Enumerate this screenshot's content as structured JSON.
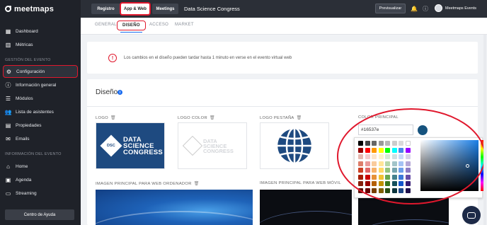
{
  "brand": {
    "name": "meetmaps",
    "logo_icon": "meetmaps-logo-icon"
  },
  "sidebar": {
    "items_top": [
      {
        "label": "Dashboard",
        "icon": "grid-icon"
      },
      {
        "label": "Métricas",
        "icon": "bar-chart-icon"
      }
    ],
    "section_event": "GESTIÓN DEL EVENTO",
    "items_event": [
      {
        "label": "Configuración",
        "icon": "gear-icon",
        "active": true
      },
      {
        "label": "Información general",
        "icon": "info-icon"
      },
      {
        "label": "Módulos",
        "icon": "list-icon"
      },
      {
        "label": "Lista de asistentes",
        "icon": "users-icon"
      },
      {
        "label": "Propiedades",
        "icon": "properties-icon"
      },
      {
        "label": "Emails",
        "icon": "envelope-icon"
      }
    ],
    "section_info": "INFORMACIÓN DEL EVENTO",
    "items_info": [
      {
        "label": "Home",
        "icon": "home-icon"
      },
      {
        "label": "Agenda",
        "icon": "calendar-icon"
      },
      {
        "label": "Streaming",
        "icon": "streaming-icon"
      }
    ],
    "help_label": "Centro de Ayuda"
  },
  "topbar": {
    "tabs": [
      {
        "label": "Registro"
      },
      {
        "label": "App & Web",
        "active": true
      },
      {
        "label": "Meetings"
      }
    ],
    "event_title": "Data Science Congress",
    "preview_label": "Previsualizar",
    "user_name": "Meetmaps Events"
  },
  "subtabs": [
    {
      "label": "GENERAL"
    },
    {
      "label": "DISEÑO",
      "active": true
    },
    {
      "label": "ACCESO"
    },
    {
      "label": "MARKET"
    }
  ],
  "notice": {
    "text": "Los cambios en el diseño pueden tardar hasta 1 minuto en verse en el evento virtual web"
  },
  "design": {
    "title": "Diseño",
    "fields": {
      "logo": "LOGO",
      "logo_color": "LOGO COLOR",
      "logo_tab": "LOGO PESTAÑA",
      "primary_color": "COLOR PRINCIPAL",
      "main_image_desktop": "IMAGEN PRINCIPAL PARA WEB ORDENADOR",
      "main_image_mobile": "IMAGEN PRINCIPAL PARA WEB MÓVIL"
    },
    "logo_image": {
      "badge": "DSC",
      "line1": "DATA",
      "line2": "SCIENCE",
      "line3": "CONGRESS"
    },
    "primary_color_value": "#16537e",
    "swatches": [
      "#000000",
      "#444444",
      "#666666",
      "#999999",
      "#b7b7b7",
      "#cccccc",
      "#d9d9d9",
      "#ffffff",
      "#980000",
      "#ff0000",
      "#ff9900",
      "#ffff00",
      "#00ff00",
      "#00ffff",
      "#4a86e8",
      "#9900ff",
      "#e6b8af",
      "#f4cccc",
      "#fce5cd",
      "#fff2cc",
      "#d9ead3",
      "#d0e0e3",
      "#c9daf8",
      "#d9d2e9",
      "#dd7e6b",
      "#ea9999",
      "#f9cb9c",
      "#ffe599",
      "#b6d7a8",
      "#a2c4c9",
      "#a4c2f4",
      "#b4a7d6",
      "#cc4125",
      "#e06666",
      "#f6b26b",
      "#ffd966",
      "#93c47d",
      "#76a5af",
      "#6d9eeb",
      "#8e7cc3",
      "#a61c00",
      "#cc0000",
      "#e69138",
      "#f1c232",
      "#6aa84f",
      "#45818e",
      "#3c78d8",
      "#674ea7",
      "#85200c",
      "#990000",
      "#b45f06",
      "#bf9000",
      "#38761d",
      "#134f5c",
      "#1155cc",
      "#351c75",
      "#5b0f00",
      "#660000",
      "#783f04",
      "#7f6000",
      "#274e13",
      "#0c343d",
      "#1c4587",
      "#20124d"
    ]
  }
}
